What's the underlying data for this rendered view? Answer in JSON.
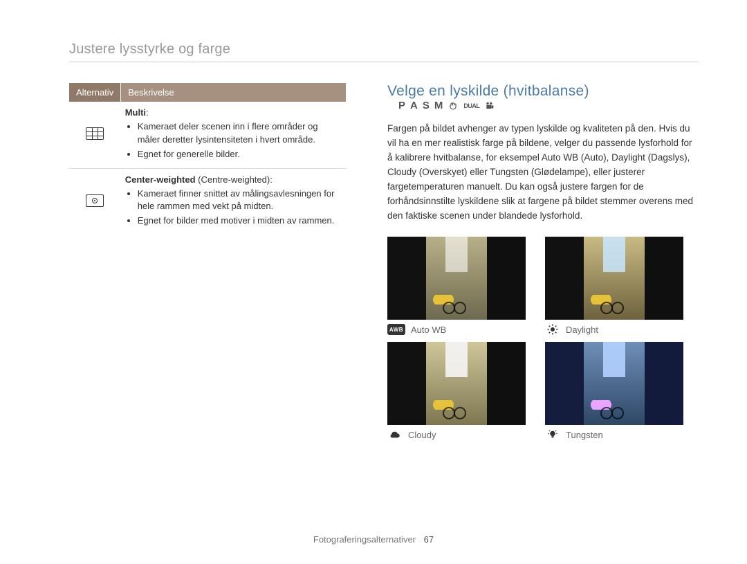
{
  "breadcrumb": "Justere lysstyrke og farge",
  "table": {
    "head_alt": "Alternativ",
    "head_desc": "Beskrivelse",
    "rows": [
      {
        "icon": "multi",
        "title": "Multi",
        "title_suffix": ":",
        "bullets": [
          "Kameraet deler scenen inn i flere områder og måler deretter lysintensiteten i hvert område.",
          "Egnet for generelle bilder."
        ]
      },
      {
        "icon": "center",
        "title": "Center-weighted",
        "title_suffix": " (Centre-weighted):",
        "bullets": [
          "Kameraet finner snittet av målingsavlesningen for hele rammen med vekt på midten.",
          "Egnet for bilder med motiver i midten av rammen."
        ]
      }
    ]
  },
  "section_title": "Velge en lyskilde (hvitbalanse)",
  "modes": {
    "p": "P",
    "a": "A",
    "s": "S",
    "m": "M",
    "dual": "DUAL"
  },
  "bodytext": "Fargen på bildet avhenger av typen lyskilde og kvaliteten på den. Hvis du vil ha en mer realistisk farge på bildene, velger du passende lysforhold for å kalibrere hvitbalanse, for eksempel Auto WB (Auto), Daylight (Dagslys), Cloudy (Overskyet) eller Tungsten (Glødelampe), eller justerer fargetemperaturen manuelt. Du kan også justere fargen for de forhåndsinnstilte lyskildene slik at fargene på bildet stemmer overens med den faktiske scenen under blandede lysforhold.",
  "wb": [
    {
      "key": "auto",
      "label": "Auto WB",
      "icon": "awb",
      "awb_text": "AWB"
    },
    {
      "key": "day",
      "label": "Daylight",
      "icon": "sun"
    },
    {
      "key": "cloud",
      "label": "Cloudy",
      "icon": "cloud"
    },
    {
      "key": "tung",
      "label": "Tungsten",
      "icon": "bulb"
    }
  ],
  "footer": {
    "section": "Fotograferingsalternativer",
    "page": "67"
  }
}
